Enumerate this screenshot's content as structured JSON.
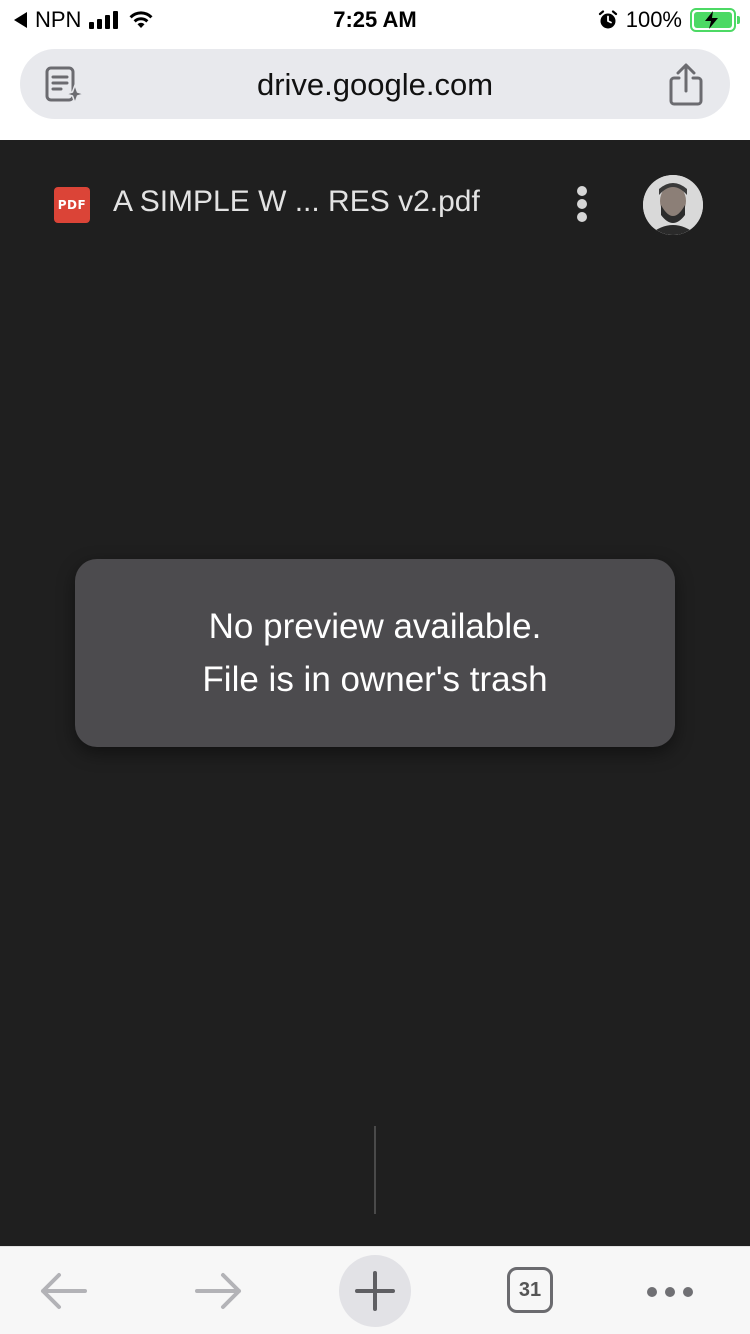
{
  "status_bar": {
    "back_app": "NPN",
    "time": "7:25 AM",
    "battery_percent": "100%",
    "battery_charging": true,
    "signal_bars": 4,
    "icons": [
      "back-arrow-icon",
      "signal-icon",
      "wifi-icon",
      "alarm-icon",
      "battery-icon"
    ]
  },
  "browser": {
    "url": "drive.google.com",
    "left_icon": "reader-mode-icon",
    "right_icon": "share-icon"
  },
  "viewer": {
    "file_type_badge": "PDF",
    "file_title": "A SIMPLE W ... RES v2.pdf",
    "menu_icon": "more-vert-icon",
    "avatar": "user-avatar"
  },
  "toast": {
    "line1": "No preview available.",
    "line2": "File is in owner's trash"
  },
  "toolbar": {
    "tab_count": "31",
    "icons": [
      "back-arrow-icon",
      "forward-arrow-icon",
      "new-tab-icon",
      "tab-switcher-icon",
      "more-horiz-icon"
    ]
  },
  "colors": {
    "viewer_bg": "#1f1f1f",
    "toast_bg": "#4c4b4e",
    "pdf_badge": "#db4437",
    "battery_green": "#4cd964",
    "url_pill": "#e8e9ed"
  }
}
